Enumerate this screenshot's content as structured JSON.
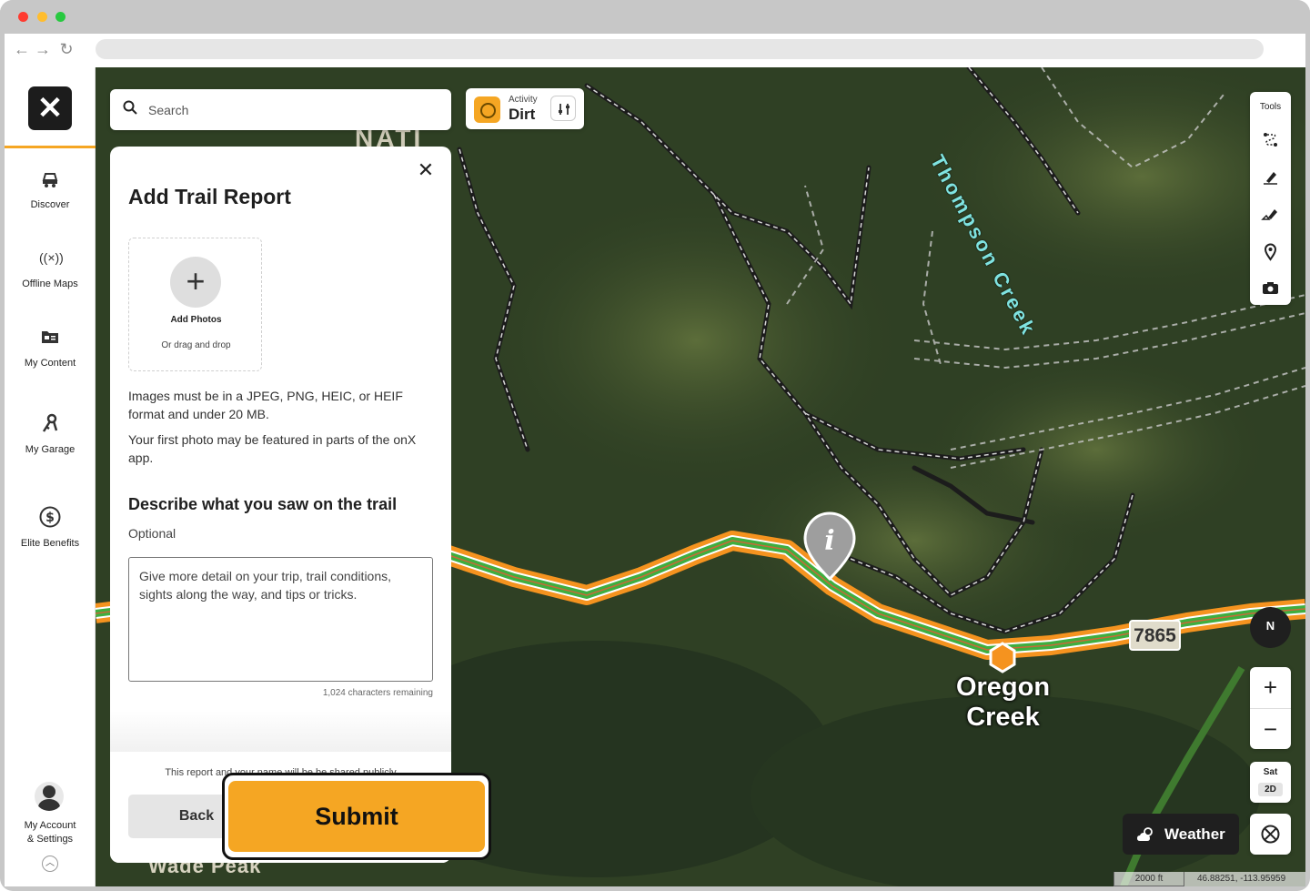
{
  "sidebar": {
    "logo_glyph": "✕",
    "items": [
      {
        "label": "Discover",
        "icon": "offroad-car-icon"
      },
      {
        "label": "Offline Maps",
        "icon": "offline-signal-icon"
      },
      {
        "label": "My Content",
        "icon": "folder-card-icon"
      },
      {
        "label": "My Garage",
        "icon": "garage-keys-icon"
      },
      {
        "label": "Elite Benefits",
        "icon": "dollar-circle-icon"
      }
    ],
    "account_line1": "My Account",
    "account_line2": "& Settings"
  },
  "search": {
    "placeholder": "Search"
  },
  "activity": {
    "label": "Activity",
    "value": "Dirt"
  },
  "panel": {
    "title": "Add Trail Report",
    "add_photos": "Add Photos",
    "drag_drop": "Or drag and drop",
    "info_format": "Images must be in a JPEG, PNG, HEIC, or HEIF format and under 20 MB.",
    "info_featured": "Your first photo may be featured in parts of the onX app.",
    "describe_title": "Describe what you saw on the trail",
    "optional": "Optional",
    "textarea_placeholder": "Give more detail on your trip, trail conditions, sights along the way, and tips or tricks.",
    "chars_remaining": "1,024 characters remaining",
    "share_note": "This report and your name will be be shared publicly",
    "back": "Back",
    "submit": "Submit"
  },
  "tools": {
    "label": "Tools"
  },
  "compass": {
    "label": "N"
  },
  "layer": {
    "sat": "Sat",
    "mode": "2D"
  },
  "weather": {
    "label": "Weather"
  },
  "map": {
    "creek_label": "Thompson Creek",
    "road_number": "7865",
    "place_line1": "Oregon",
    "place_line2": "Creek",
    "peak_label": "Wade Peak",
    "nat_label": "NATI",
    "scale": "2000 ft",
    "coords": "46.88251, -113.95959"
  },
  "colors": {
    "accent": "#f5a623",
    "trail_green": "#3fae3f",
    "dark": "#1f1f1f"
  }
}
